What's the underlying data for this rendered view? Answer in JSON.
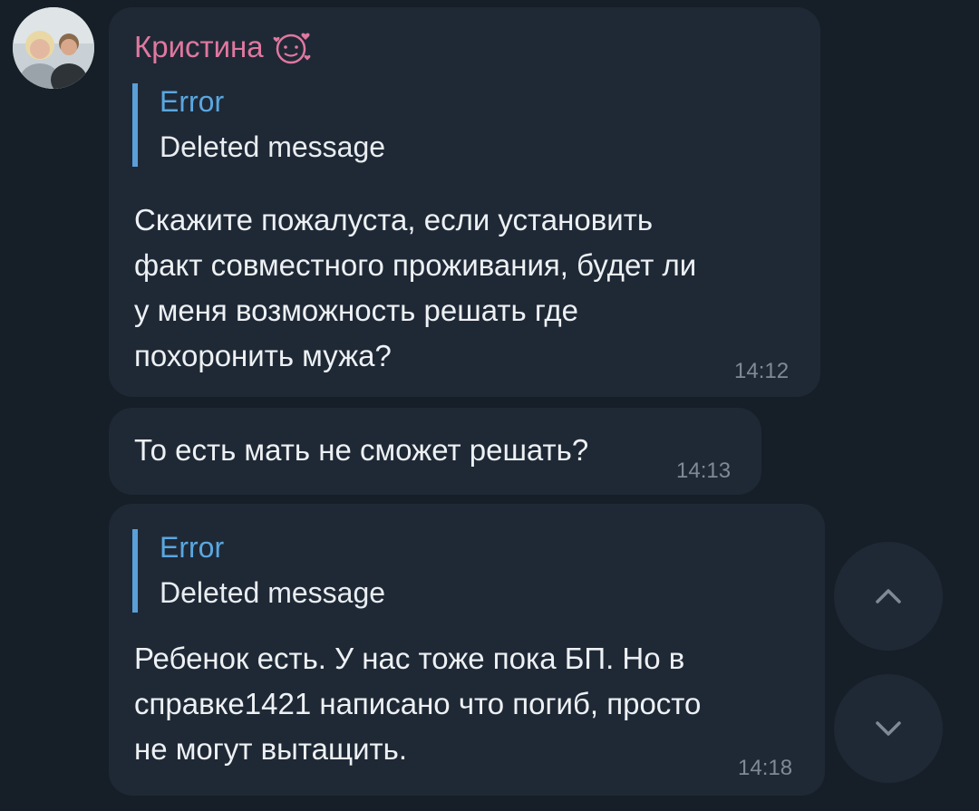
{
  "messages": [
    {
      "sender": "Кристина",
      "reply": {
        "name": "Error",
        "text": "Deleted message"
      },
      "text": "Скажите пожалуста, если установить\nфакт совместного проживания, будет ли\nу меня возможность решать где\nпохоронить мужа?",
      "time": "14:12"
    },
    {
      "text": "То есть мать не сможет решать?",
      "time": "14:13"
    },
    {
      "reply": {
        "name": "Error",
        "text": "Deleted message"
      },
      "text": "Ребенок есть. У нас тоже пока БП. Но в\nсправке1421 написано что погиб, просто\nне могут вытащить.",
      "time": "14:18"
    }
  ],
  "icons": {
    "sender_emoji": "face-with-hearts-icon",
    "scroll_up": "chevron-up-icon",
    "scroll_down": "chevron-down-icon"
  },
  "colors": {
    "background": "#161f28",
    "bubble": "#1f2936",
    "sender_name": "#e0789f",
    "reply_accent": "#5aa7e0",
    "timestamp": "#7f8a96"
  }
}
